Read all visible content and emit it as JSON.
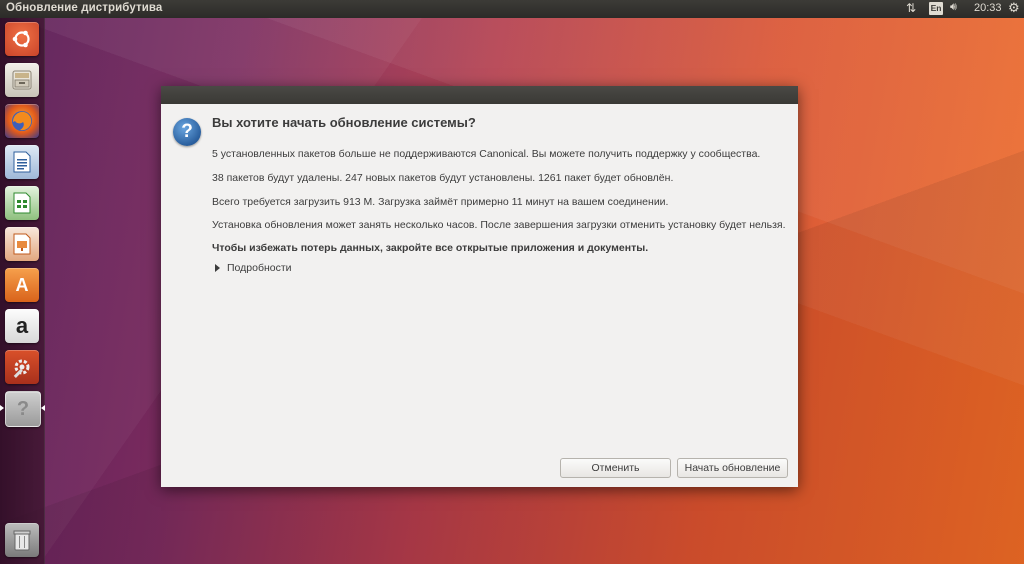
{
  "top_panel": {
    "window_title": "Обновление дистрибутива",
    "language_indicator": "En",
    "clock": "20:33",
    "icons": [
      "network-icon",
      "volume-icon",
      "settings-gear-icon"
    ]
  },
  "launcher": {
    "items": [
      {
        "name": "dash-home",
        "icon": "ubuntu-logo-icon"
      },
      {
        "name": "files",
        "icon": "file-cabinet-icon"
      },
      {
        "name": "firefox",
        "icon": "firefox-icon"
      },
      {
        "name": "libreoffice-writer",
        "icon": "writer-icon"
      },
      {
        "name": "libreoffice-calc",
        "icon": "calc-icon"
      },
      {
        "name": "libreoffice-impress",
        "icon": "impress-icon"
      },
      {
        "name": "ubuntu-software",
        "icon": "software-bag-icon",
        "glyph": "A"
      },
      {
        "name": "amazon",
        "icon": "amazon-icon",
        "glyph": "a"
      },
      {
        "name": "system-settings",
        "icon": "wrench-gear-icon"
      },
      {
        "name": "unknown-app",
        "icon": "question-mark-icon",
        "glyph": "?"
      },
      {
        "name": "trash",
        "icon": "trash-icon"
      }
    ]
  },
  "dialog": {
    "heading": "Вы хотите начать обновление системы?",
    "paragraphs": [
      "5 установленных пакетов больше не поддерживаются Canonical. Вы можете получить поддержку у сообщества.",
      "38 пакетов будут удалены. 247 новых пакетов будут установлены. 1261 пакет будет обновлён.",
      "Всего требуется загрузить 913 М. Загрузка займёт примерно 11 минут на вашем соединении.",
      "Установка обновления может занять несколько часов. После завершения загрузки отменить установку будет нельзя.",
      "Чтобы избежать потерь данных, закройте все открытые приложения и документы."
    ],
    "details_label": "Подробности",
    "cancel_label": "Отменить",
    "start_label": "Начать обновление"
  },
  "colors": {
    "panel_bg": "#3c3b37",
    "dialog_bg": "#f2f1f0",
    "launcher_bg": "#3a1230",
    "wallpaper_left": "#5b1e58",
    "wallpaper_right": "#ee6a25"
  }
}
